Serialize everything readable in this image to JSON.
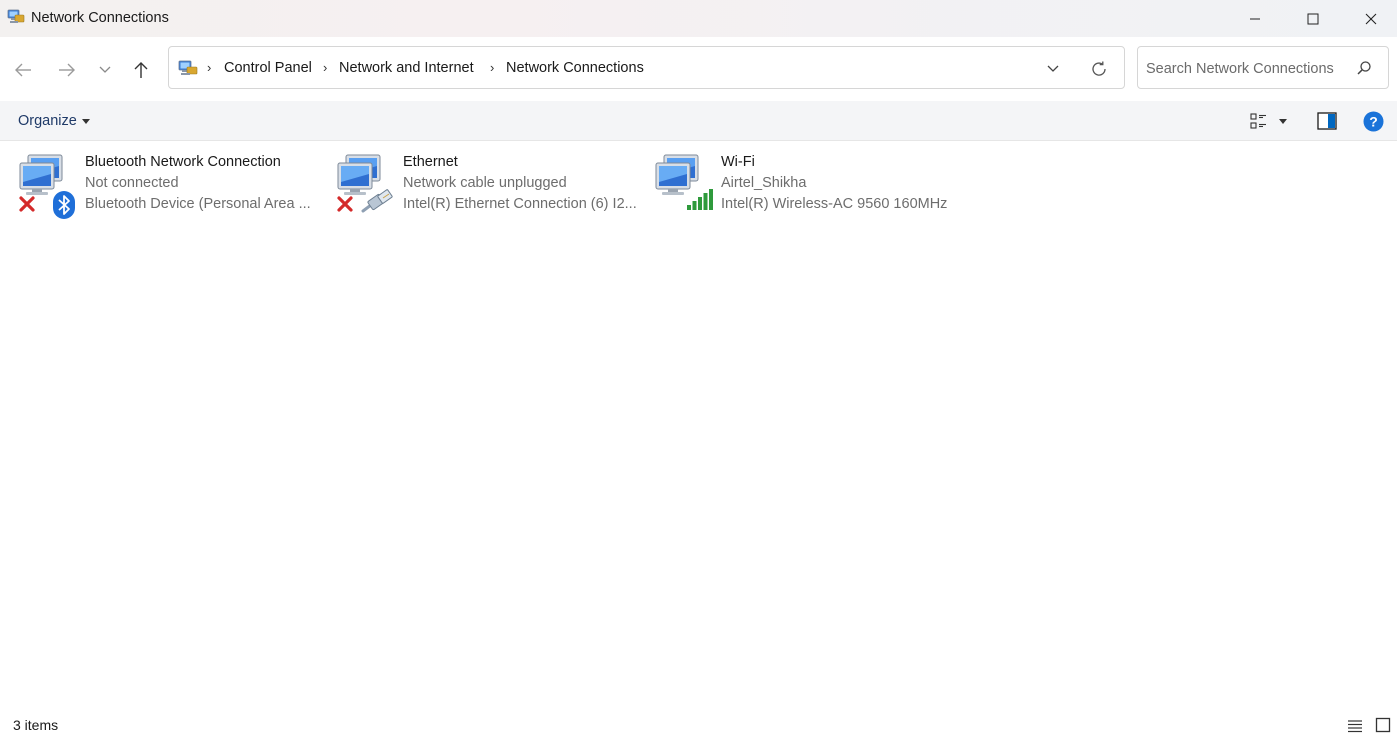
{
  "window": {
    "title": "Network Connections",
    "controls": [
      "minimize",
      "maximize",
      "close"
    ]
  },
  "navigation": {
    "back_icon": "arrow-left-icon",
    "forward_icon": "arrow-right-icon",
    "recent_icon": "chevron-down-icon",
    "up_icon": "arrow-up-icon",
    "breadcrumb": [
      "Control Panel",
      "Network and Internet",
      "Network Connections"
    ],
    "refresh_icon": "refresh-icon"
  },
  "search": {
    "placeholder": "Search Network Connections",
    "value": ""
  },
  "commandbar": {
    "organize_label": "Organize",
    "help_label": "?"
  },
  "connections": [
    {
      "name": "Bluetooth Network Connection",
      "status": "Not connected",
      "device": "Bluetooth Device (Personal Area ...",
      "adapter_icon": "bluetooth-icon",
      "state_icon": "red-x-icon"
    },
    {
      "name": "Ethernet",
      "status": "Network cable unplugged",
      "device": "Intel(R) Ethernet Connection (6) I2...",
      "adapter_icon": "ethernet-cable-icon",
      "state_icon": "red-x-icon"
    },
    {
      "name": "Wi-Fi",
      "status": "Airtel_Shikha",
      "device": "Intel(R) Wireless-AC 9560 160MHz",
      "adapter_icon": "wifi-signal-bars-icon",
      "state_icon": ""
    }
  ],
  "statusbar": {
    "item_count": "3 items"
  },
  "colors": {
    "accent": "#0067c0",
    "error": "#d42a2a",
    "signal": "#2f9a3c",
    "muted_text": "#6d6d6d"
  }
}
